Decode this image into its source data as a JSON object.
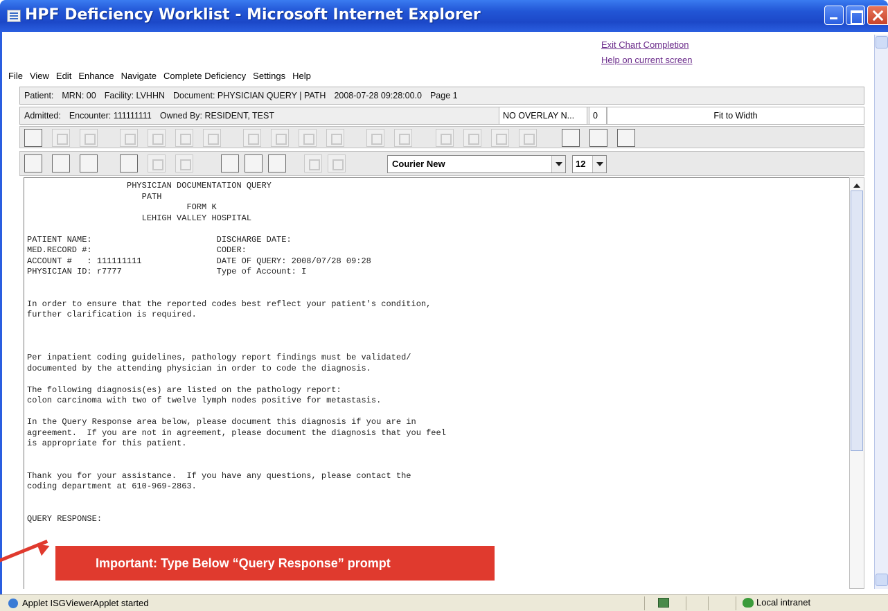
{
  "window": {
    "title": "HPF Deficiency Worklist - Microsoft Internet Explorer"
  },
  "links": {
    "exit": "Exit Chart Completion",
    "help": "Help on current screen"
  },
  "menu": [
    "File",
    "View",
    "Edit",
    "Enhance",
    "Navigate",
    "Complete Deficiency",
    "Settings",
    "Help"
  ],
  "patient_bar": {
    "patient": "Patient:",
    "mrn": "MRN: 00",
    "facility": "Facility: LVHHN",
    "document": "Document: PHYSICIAN QUERY | PATH",
    "datetime": "2008-07-28 09:28:00.0",
    "page": "Page 1"
  },
  "admitted_bar": {
    "admitted": "Admitted:",
    "encounter": "Encounter: 111111111",
    "owner": "Owned By: RESIDENT, TEST",
    "overlay": "NO OVERLAY N...",
    "count": "0",
    "fit": "Fit to Width"
  },
  "format_toolbar": {
    "font": "Courier New",
    "size": "12"
  },
  "document_text": "                    PHYSICIAN DOCUMENTATION QUERY\n                       PATH\n                                FORM K\n                       LEHIGH VALLEY HOSPITAL\n\nPATIENT NAME:                         DISCHARGE DATE:\nMED.RECORD #:                         CODER:\nACCOUNT #   : 111111111               DATE OF QUERY: 2008/07/28 09:28\nPHYSICIAN ID: r7777                   Type of Account: I\n\n\nIn order to ensure that the reported codes best reflect your patient's condition,\nfurther clarification is required.\n\n\n\nPer inpatient coding guidelines, pathology report findings must be validated/\ndocumented by the attending physician in order to code the diagnosis.\n\nThe following diagnosis(es) are listed on the pathology report:\ncolon carcinoma with two of twelve lymph nodes positive for metastasis.\n\nIn the Query Response area below, please document this diagnosis if you are in\nagreement.  If you are not in agreement, please document the diagnosis that you feel\nis appropriate for this patient.\n\n\nThank you for your assistance.  If you have any questions, please contact the\ncoding department at 610-969-2863.\n\n\nQUERY RESPONSE:",
  "callout": "Important:  Type Below “Query Response” prompt",
  "status": {
    "text": "Applet ISGViewerApplet started",
    "zone": "Local intranet"
  },
  "colors": {
    "titlebar": "#2256d6",
    "callout": "#e03a2e"
  }
}
